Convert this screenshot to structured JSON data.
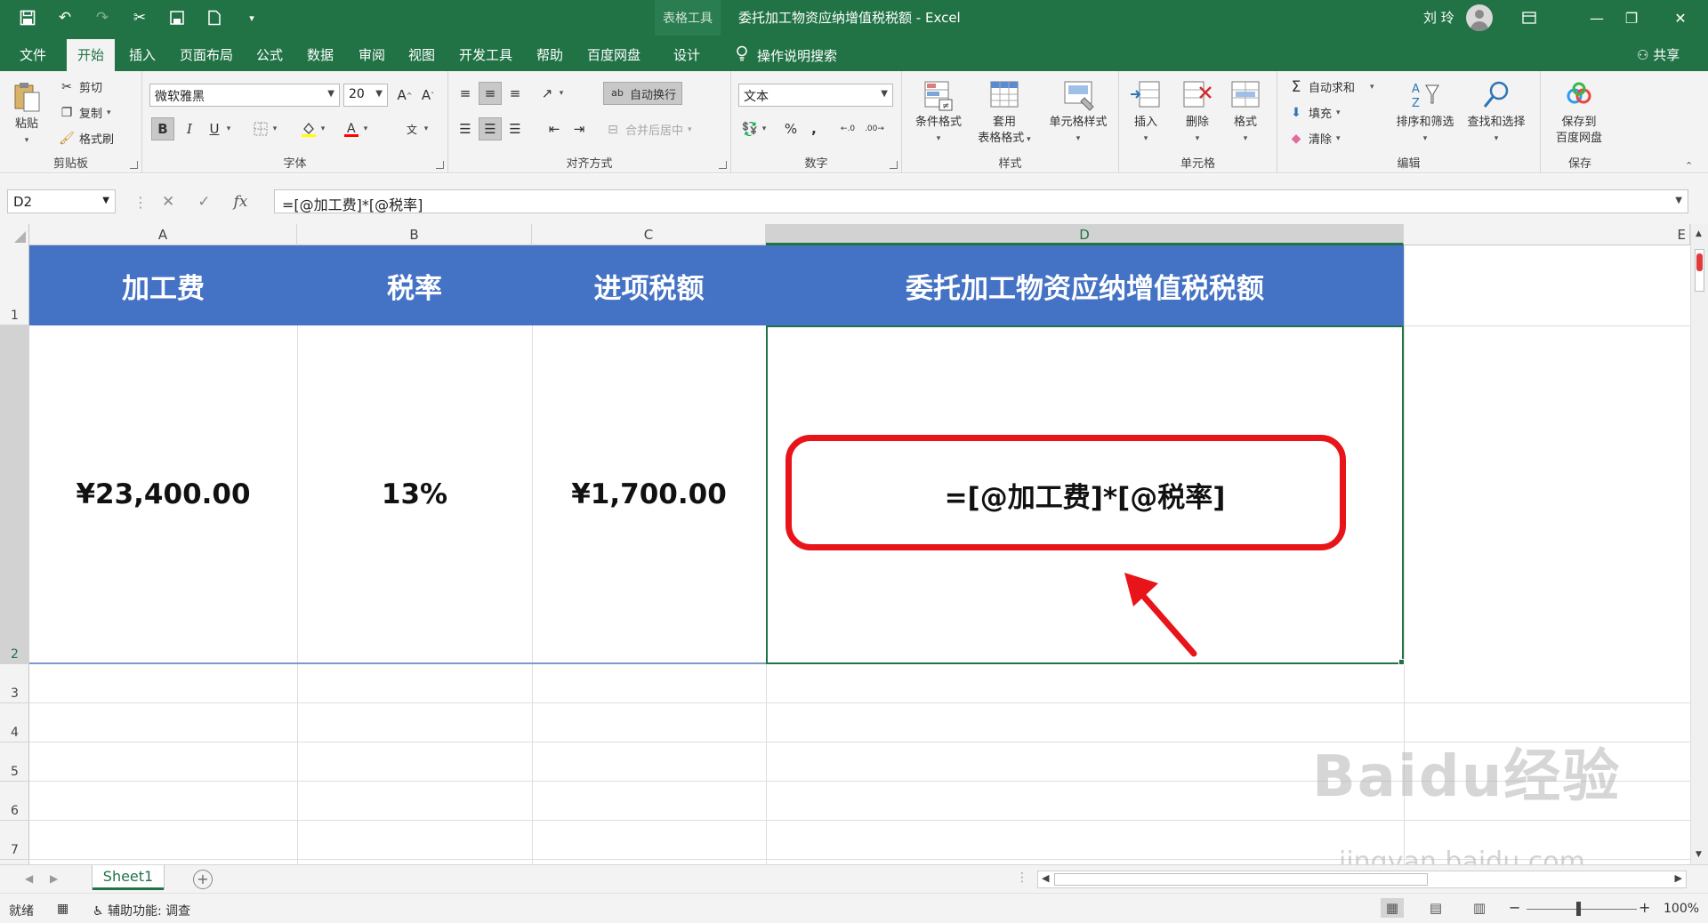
{
  "titlebar": {
    "context_label": "表格工具",
    "document_title": "委托加工物资应纳增值税税额",
    "app_name": "Excel",
    "user_name": "刘 玲",
    "quick_access_icons": [
      "save-icon",
      "undo-icon",
      "redo-icon",
      "cut-icon",
      "save-as-icon",
      "new-doc-icon",
      "customize-qat-icon"
    ],
    "window_controls": [
      "ribbon-display-icon",
      "minimize-icon",
      "restore-icon",
      "close-icon"
    ]
  },
  "menu": {
    "tabs": [
      "文件",
      "开始",
      "插入",
      "页面布局",
      "公式",
      "数据",
      "审阅",
      "视图",
      "开发工具",
      "帮助",
      "百度网盘",
      "设计"
    ],
    "active_tab": "开始",
    "search_label": "操作说明搜索",
    "share_label": "共享"
  },
  "ribbon": {
    "clipboard": {
      "label": "剪贴板",
      "paste": "粘贴",
      "cut": "剪切",
      "copy": "复制",
      "format_painter": "格式刷"
    },
    "font": {
      "label": "字体",
      "font_name": "微软雅黑",
      "font_size": "20",
      "bold": "B",
      "italic": "I",
      "underline": "U"
    },
    "alignment": {
      "label": "对齐方式",
      "wrap_text": "自动换行",
      "merge_center": "合并后居中"
    },
    "number": {
      "label": "数字",
      "format": "文本"
    },
    "styles": {
      "label": "样式",
      "conditional": "条件格式",
      "table_format_1": "套用",
      "table_format_2": "表格格式",
      "cell_styles": "单元格样式"
    },
    "cells": {
      "label": "单元格",
      "insert": "插入",
      "delete": "删除",
      "format": "格式"
    },
    "editing": {
      "label": "编辑",
      "autosum": "自动求和",
      "fill": "填充",
      "clear": "清除",
      "sort_filter": "排序和筛选",
      "find_select": "查找和选择"
    },
    "save": {
      "label": "保存",
      "save_to_1": "保存到",
      "save_to_2": "百度网盘"
    }
  },
  "formula_bar": {
    "name_box": "D2",
    "formula": "=[@加工费]*[@税率]",
    "fx": "fx"
  },
  "grid": {
    "columns": [
      "A",
      "B",
      "C",
      "D",
      "E"
    ],
    "rows": [
      "1",
      "2",
      "3",
      "4",
      "5",
      "6",
      "7"
    ],
    "selected_column": "D",
    "selected_row": "2",
    "header_row": [
      "加工费",
      "税率",
      "进项税额",
      "委托加工物资应纳增值税税额"
    ],
    "data_row": [
      "¥23,400.00",
      "13%",
      "¥1,700.00",
      "=[@加工费]*[@税率]"
    ],
    "header_fill": "#4472c4",
    "highlight_color": "#e8141a"
  },
  "sheet_tabs": {
    "tabs": [
      "Sheet1"
    ],
    "active": "Sheet1"
  },
  "statusbar": {
    "ready": "就绪",
    "accessibility": "辅助功能: 调查",
    "zoom": "100%"
  },
  "watermark": {
    "brand": "Baidu经验",
    "url": "jingyan.baidu.com"
  }
}
